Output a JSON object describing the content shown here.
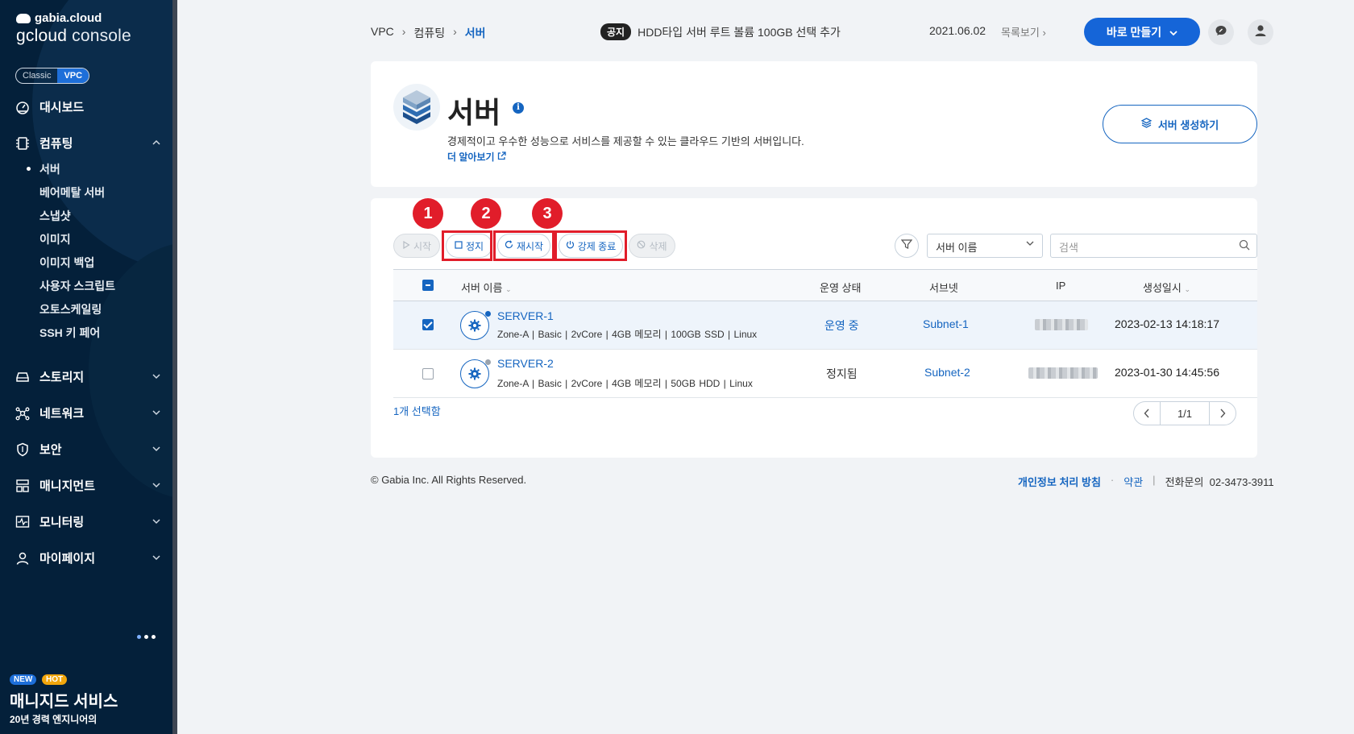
{
  "sidebar": {
    "brand_top": "gabia.cloud",
    "brand_console_a": "gcloud",
    "brand_console_b": " console",
    "toggle": [
      "Classic",
      "VPC"
    ],
    "items": [
      {
        "label": "대시보드",
        "icon": "dashboard-icon"
      },
      {
        "label": "컴퓨팅",
        "icon": "server-chip-icon",
        "expanded": true
      },
      {
        "label": "스토리지",
        "icon": "storage-icon"
      },
      {
        "label": "네트워크",
        "icon": "network-icon"
      },
      {
        "label": "보안",
        "icon": "shield-icon"
      },
      {
        "label": "매니지먼트",
        "icon": "management-icon"
      },
      {
        "label": "모니터링",
        "icon": "monitoring-icon"
      },
      {
        "label": "마이페이지",
        "icon": "user-icon"
      }
    ],
    "sub_items": [
      "서버",
      "베어메탈 서버",
      "스냅샷",
      "이미지",
      "이미지 백업",
      "사용자 스크립트",
      "오토스케일링",
      "SSH 키 페어"
    ],
    "promo": {
      "badge_new": "NEW",
      "badge_hot": "HOT",
      "title": "매니지드 서비스",
      "subtitle": "20년 경력 엔지니어의"
    }
  },
  "topbar": {
    "breadcrumb": [
      "VPC",
      "컴퓨팅",
      "서버"
    ],
    "notice_tag": "공지",
    "notice_text": "HDD타입 서버 루트 볼륨 100GB 선택 추가",
    "notice_date": "2021.06.02",
    "notice_more": "목록보기",
    "quick_create": "바로 만들기"
  },
  "hero": {
    "title": "서버",
    "description": "경제적이고 우수한 성능으로 서비스를 제공할 수 있는 클라우드 기반의 서버입니다.",
    "learn_more": "더 알아보기",
    "create_button": "서버 생성하기"
  },
  "toolbar": {
    "start": "시작",
    "stop": "정지",
    "restart": "재시작",
    "force_stop": "강제 종료",
    "delete": "삭제",
    "badges": [
      "1",
      "2",
      "3"
    ],
    "filter_select": "서버 이름",
    "search_placeholder": "검색"
  },
  "table": {
    "headers": [
      "서버 이름",
      "운영 상태",
      "서브넷",
      "IP",
      "생성일시"
    ],
    "rows": [
      {
        "name": "SERVER-1",
        "spec": "Zone-A  |  Basic  |  2vCore  |  4GB 메모리  |  100GB SSD  |  Linux",
        "status": "운영 중",
        "subnet": "Subnet-1",
        "created": "2023-02-13 14:18:17",
        "checked": true,
        "status_color": "#1565c0"
      },
      {
        "name": "SERVER-2",
        "spec": "Zone-A  |  Basic  |  2vCore  |  4GB 메모리  |  50GB HDD  |  Linux",
        "status": "정지됨",
        "subnet": "Subnet-2",
        "created": "2023-01-30 14:45:56",
        "checked": false,
        "status_color": "#9aa3ad"
      }
    ],
    "selected_count": "1개 선택함",
    "page": "1/1"
  },
  "footer": {
    "copyright": "© Gabia Inc. All Rights Reserved.",
    "privacy": "개인정보 처리 방침",
    "dot": "·",
    "terms": "약관",
    "sep": "|",
    "phone": "전화문의  02-3473-3911"
  },
  "colors": {
    "sidebar_bg": "#04203a",
    "accent": "#1565c0",
    "highlight_red": "#e11d2a"
  }
}
